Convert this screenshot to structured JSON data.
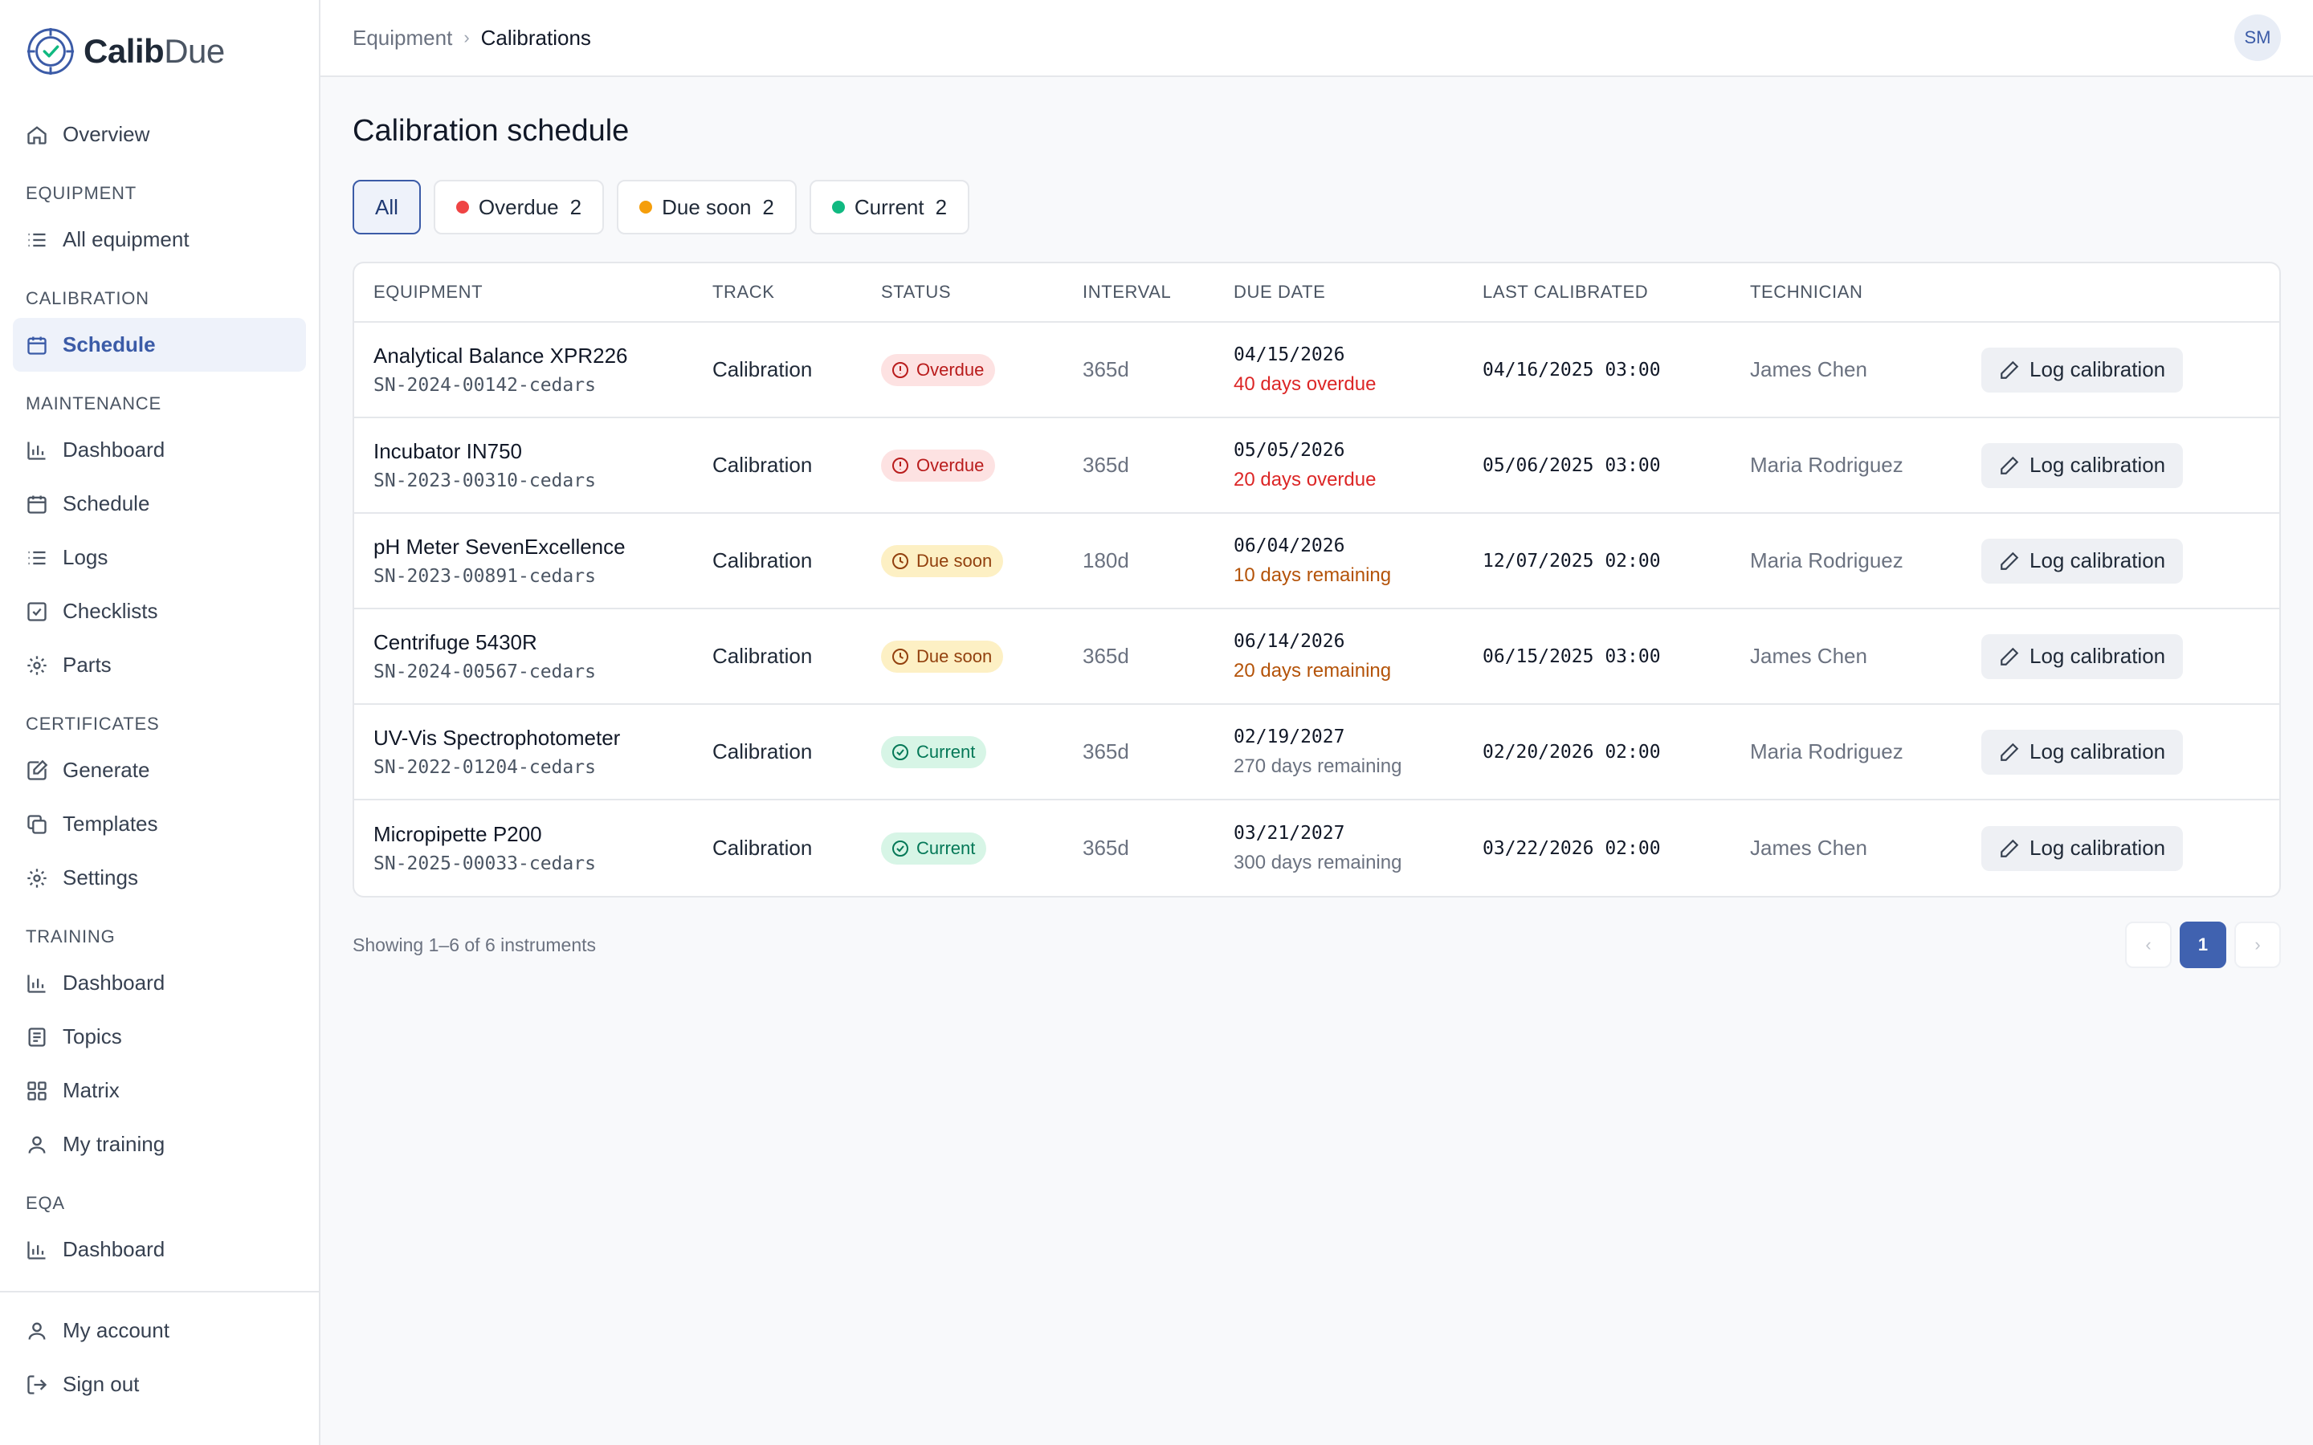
{
  "brand": {
    "name_bold": "Calib",
    "name_light": "Due",
    "accent": "#3b5ba7"
  },
  "sidebar": {
    "overview": "Overview",
    "sections": [
      {
        "title": "EQUIPMENT",
        "items": [
          "All equipment"
        ]
      },
      {
        "title": "CALIBRATION",
        "items": [
          "Schedule"
        ]
      },
      {
        "title": "MAINTENANCE",
        "items": [
          "Dashboard",
          "Schedule",
          "Logs",
          "Checklists",
          "Parts"
        ]
      },
      {
        "title": "CERTIFICATES",
        "items": [
          "Generate",
          "Templates",
          "Settings"
        ]
      },
      {
        "title": "TRAINING",
        "items": [
          "Dashboard",
          "Topics",
          "Matrix",
          "My training"
        ]
      },
      {
        "title": "EQA",
        "items": [
          "Dashboard"
        ]
      }
    ],
    "bottom": [
      "My account",
      "Sign out"
    ]
  },
  "topbar": {
    "breadcrumb_parent": "Equipment",
    "breadcrumb_current": "Calibrations",
    "avatar_initials": "SM"
  },
  "page": {
    "title": "Calibration schedule"
  },
  "filters": [
    {
      "label": "All",
      "count": ""
    },
    {
      "label": "Overdue",
      "count": "2",
      "color": "#ef4444"
    },
    {
      "label": "Due soon",
      "count": "2",
      "color": "#f59e0b"
    },
    {
      "label": "Current",
      "count": "2",
      "color": "#10b981"
    }
  ],
  "table": {
    "headers": [
      "EQUIPMENT",
      "TRACK",
      "STATUS",
      "INTERVAL",
      "DUE DATE",
      "LAST CALIBRATED",
      "TECHNICIAN"
    ],
    "action_label": "Log calibration",
    "rows": [
      {
        "name": "Analytical Balance XPR226",
        "serial": "SN-2024-00142-cedars",
        "track": "Calibration",
        "status": "Overdue",
        "interval": "365d",
        "due_date": "04/15/2026",
        "due_note": "40 days overdue",
        "last": "04/16/2025 03:00",
        "tech": "James Chen"
      },
      {
        "name": "Incubator IN750",
        "serial": "SN-2023-00310-cedars",
        "track": "Calibration",
        "status": "Overdue",
        "interval": "365d",
        "due_date": "05/05/2026",
        "due_note": "20 days overdue",
        "last": "05/06/2025 03:00",
        "tech": "Maria Rodriguez"
      },
      {
        "name": "pH Meter SevenExcellence",
        "serial": "SN-2023-00891-cedars",
        "track": "Calibration",
        "status": "Due soon",
        "interval": "180d",
        "due_date": "06/04/2026",
        "due_note": "10 days remaining",
        "last": "12/07/2025 02:00",
        "tech": "Maria Rodriguez"
      },
      {
        "name": "Centrifuge 5430R",
        "serial": "SN-2024-00567-cedars",
        "track": "Calibration",
        "status": "Due soon",
        "interval": "365d",
        "due_date": "06/14/2026",
        "due_note": "20 days remaining",
        "last": "06/15/2025 03:00",
        "tech": "James Chen"
      },
      {
        "name": "UV-Vis Spectrophotometer",
        "serial": "SN-2022-01204-cedars",
        "track": "Calibration",
        "status": "Current",
        "interval": "365d",
        "due_date": "02/19/2027",
        "due_note": "270 days remaining",
        "last": "02/20/2026 02:00",
        "tech": "Maria Rodriguez"
      },
      {
        "name": "Micropipette P200",
        "serial": "SN-2025-00033-cedars",
        "track": "Calibration",
        "status": "Current",
        "interval": "365d",
        "due_date": "03/21/2027",
        "due_note": "300 days remaining",
        "last": "03/22/2026 02:00",
        "tech": "James Chen"
      }
    ]
  },
  "footer": {
    "showing": "Showing 1–6 of 6 instruments",
    "prev": "‹",
    "page": "1",
    "next": "›"
  }
}
